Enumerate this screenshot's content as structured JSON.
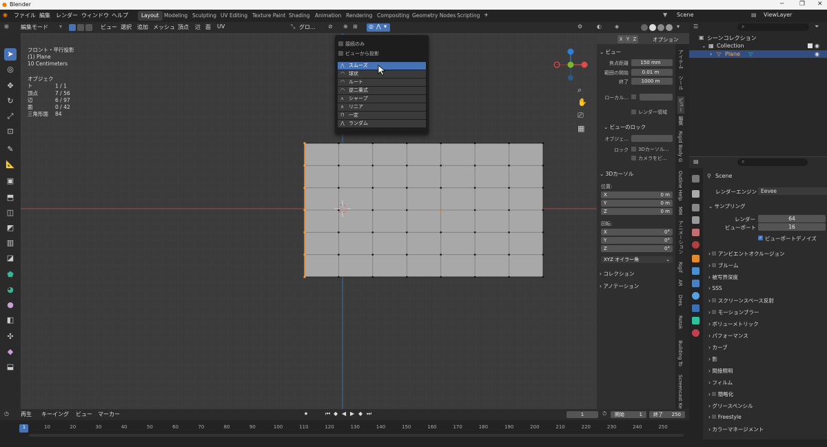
{
  "window": {
    "title": "Blender"
  },
  "menu": {
    "items": [
      "ファイル",
      "編集",
      "レンダー",
      "ウィンドウ",
      "ヘルプ"
    ],
    "workspaces": [
      "Layout",
      "Modeling",
      "Sculpting",
      "UV Editing",
      "Texture Paint",
      "Shading",
      "Animation",
      "Rendering",
      "Compositing",
      "Geometry Nodes",
      "Scripting"
    ],
    "active_workspace": "Layout",
    "add_tab": "+",
    "scene": "Scene",
    "view_layer": "ViewLayer"
  },
  "viewport_header": {
    "mode": "編集モード",
    "menus": [
      "ビュー",
      "選択",
      "追加",
      "メッシュ",
      "頂点",
      "辺",
      "面",
      "UV"
    ],
    "transform_orientation": "グロ...",
    "axes": [
      "X",
      "Y",
      "Z"
    ],
    "options": "オプション"
  },
  "viewport_overlay": {
    "view_name": "フロント・平行投影",
    "object_name": "(1) Plane",
    "scale": "10 Centimeters",
    "stats": [
      {
        "label": "オブジェクト",
        "value": "1 / 1"
      },
      {
        "label": "頂点",
        "value": "7 / 56"
      },
      {
        "label": "辺",
        "value": "6 / 97"
      },
      {
        "label": "面",
        "value": "0 / 42"
      },
      {
        "label": "三角形面",
        "value": "84"
      }
    ]
  },
  "falloff_dropdown": {
    "checks": [
      "接続のみ",
      "ビューから投影"
    ],
    "items": [
      "スムーズ",
      "球状",
      "ルート",
      "逆二乗式",
      "シャープ",
      "リニア",
      "一定",
      "ランダム"
    ],
    "highlighted": "スムーズ"
  },
  "n_panel": {
    "view_header": "ビュー",
    "focal_label": "焦点距離",
    "focal_value": "150 mm",
    "clip_start_label": "範囲の開始",
    "clip_start_value": "0.01 m",
    "clip_end_label": "終了",
    "clip_end_value": "1000 m",
    "local_camera_label": "ローカル...",
    "render_region": "レンダー領域",
    "view_lock_header": "ビューのロック",
    "lock_object_label": "オブジェ...",
    "lock_label": "ロック",
    "lock_3d_cursor": "3Dカーソル...",
    "camera_to_view": "カメラをビ...",
    "cursor_header": "3Dカーソル",
    "location_label": "位置:",
    "loc_x": "0 m",
    "loc_y": "0 m",
    "loc_z": "0 m",
    "rotation_label": "回転:",
    "rot_x": "0°",
    "rot_y": "0°",
    "rot_z": "0°",
    "rotation_mode": "XYZ オイラー角",
    "collection_header": "コレクション",
    "annotation_header": "アノテーション",
    "x": "X",
    "y": "Y",
    "z": "Z"
  },
  "vertical_tabs": [
    "アイテム",
    "ツール",
    "ビュー",
    "編集",
    "Rigid Body G",
    "Outline Help",
    "MM",
    "アニメーション",
    "Rigif",
    "AR",
    "Dres",
    "Rotok",
    "Building To",
    "Screencast Ke"
  ],
  "outliner": {
    "root": "シーンコレクション",
    "collection": "Collection",
    "object": "Plane"
  },
  "properties": {
    "scene": "Scene",
    "render_engine_label": "レンダーエンジン",
    "render_engine": "Eevee",
    "sampling_header": "サンプリング",
    "render_label": "レンダー",
    "render_samples": "64",
    "viewport_label": "ビューポート",
    "viewport_samples": "16",
    "viewport_denoise": "ビューポートデノイズ",
    "sections": [
      "アンビエントオクルージョン",
      "ブルーム",
      "被写界深度",
      "SSS",
      "スクリーンスペース反射",
      "モーションブラー",
      "ボリューメトリック",
      "パフォーマンス",
      "カーブ",
      "影",
      "間接照明",
      "フィルム",
      "簡略化",
      "グリースペンシル",
      "Freestyle",
      "カラーマネージメント"
    ]
  },
  "timeline": {
    "menus": [
      "再生",
      "キーイング",
      "ビュー",
      "マーカー"
    ],
    "current_frame": "1",
    "start_label": "開始",
    "start": "1",
    "end_label": "終了",
    "end": "250",
    "ticks": [
      "1",
      "10",
      "20",
      "30",
      "40",
      "50",
      "60",
      "70",
      "80",
      "90",
      "100",
      "110",
      "120",
      "130",
      "140",
      "150",
      "160",
      "170",
      "180",
      "190",
      "200",
      "210",
      "220",
      "230",
      "240",
      "250"
    ]
  },
  "colors": {
    "accent": "#4772b3",
    "mesh_face": "#a8a8a8",
    "x_axis": "#e04a4a",
    "y_axis": "#7ab82a",
    "z_axis": "#2e7fd9"
  }
}
